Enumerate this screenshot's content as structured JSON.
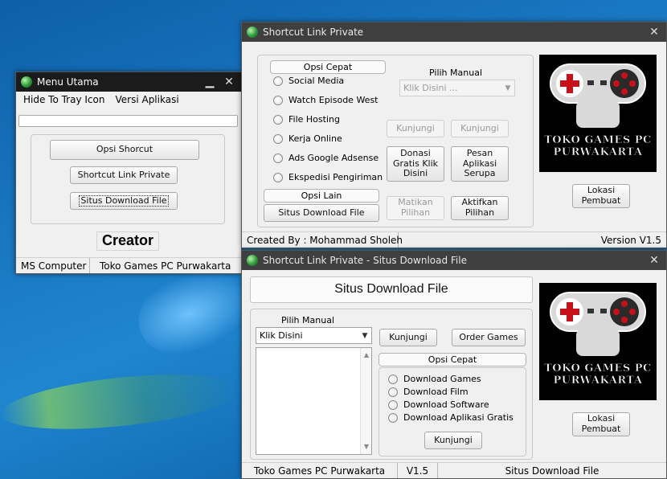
{
  "menu_utama": {
    "title": "Menu Utama",
    "menu": [
      "Hide To Tray Icon",
      "Versi Aplikasi"
    ],
    "buttons": [
      "Opsi Shorcut",
      "Shortcut Link Private",
      "Situs Download File"
    ],
    "creator": "Creator",
    "status": [
      "MS Computer",
      "Toko Games PC Purwakarta"
    ]
  },
  "shortcut": {
    "title": "Shortcut Link Private",
    "opsi_cepat": "Opsi Cepat",
    "radios": [
      "Social Media",
      "Watch Episode West",
      "File Hosting",
      "Kerja Online",
      "Ads Google Adsense",
      "Ekspedisi Pengiriman"
    ],
    "opsi_lain": "Opsi Lain",
    "situs_btn": "Situs Download File",
    "pilih_manual": "Pilih Manual",
    "select_value": "Klik Disini ...",
    "kunjungi_1": "Kunjungi",
    "kunjungi_2": "Kunjungi",
    "donasi": "Donasi Gratis Klik Disini",
    "pesan": "Pesan Aplikasi Serupa",
    "matikan": "Matikan Pilihan",
    "aktifkan": "Aktifkan Pilihan",
    "logo_text": "TOKO GAMES PC PURWAKARTA",
    "lokasi": "Lokasi Pembuat",
    "status_left": "Created By : Mohammad Sholeh",
    "status_right": "Version V1.5"
  },
  "situs": {
    "title": "Shortcut Link Private - Situs Download File",
    "heading": "Situs Download File",
    "pilih_manual": "Pilih Manual",
    "select_value": "Klik Disini",
    "kunjungi_top": "Kunjungi",
    "order": "Order Games",
    "opsi_cepat": "Opsi Cepat",
    "radios": [
      "Download Games",
      "Download Film",
      "Download Software",
      "Download Aplikasi Gratis"
    ],
    "kunjungi_bottom": "Kunjungi",
    "logo_text": "TOKO GAMES PC PURWAKARTA",
    "lokasi": "Lokasi Pembuat",
    "status": [
      "Toko Games PC Purwakarta",
      "V1.5",
      "Situs Download File"
    ]
  },
  "colors": {
    "desktop": "#1a78c2",
    "titlebar_dark": "#1b1b1b",
    "titlebar_grey": "#3f3f3f",
    "window_bg": "#f0f0f0",
    "gamepad_red": "#c8101a"
  },
  "icons": [
    "app-globe-icon",
    "minimize-icon",
    "close-icon",
    "gamepad-icon",
    "dropdown-arrow-icon",
    "scroll-up-icon",
    "scroll-down-icon"
  ]
}
